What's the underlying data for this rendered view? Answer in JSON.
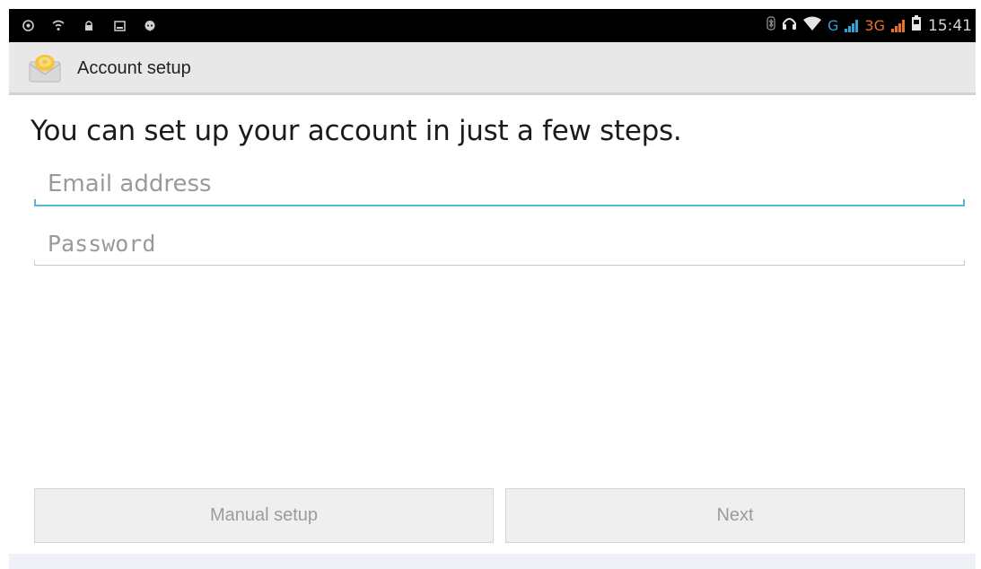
{
  "status_bar": {
    "time": "15:41",
    "network_g": "G",
    "network_3g": "3G",
    "left_icons": [
      "notification-icon",
      "wifi-notification-icon",
      "lock-icon",
      "photo-icon",
      "chat-icon"
    ],
    "right_icons": [
      "bluetooth-icon",
      "headset-icon",
      "wifi-icon",
      "signal-icon",
      "signal-icon",
      "battery-icon"
    ],
    "colors": {
      "background": "#000000",
      "accent_blue": "#2fa3d8",
      "accent_orange": "#e8722e"
    }
  },
  "action_bar": {
    "title": "Account setup",
    "icon": "email-app-icon"
  },
  "content": {
    "headline": "You can set up your account in just a few steps.",
    "email_placeholder": "Email address",
    "password_placeholder": "Password",
    "focus_color": "#56b6d3"
  },
  "buttons": {
    "manual_setup": "Manual setup",
    "next": "Next"
  }
}
